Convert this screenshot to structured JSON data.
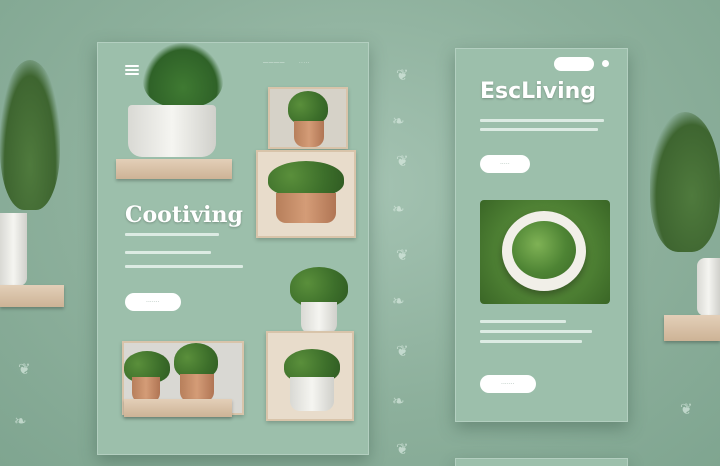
{
  "left_card": {
    "title": "Cootiving",
    "nav_links": [
      "————",
      "·····"
    ],
    "text_lines": [
      "",
      "",
      ""
    ],
    "button_label": "·······"
  },
  "right_card": {
    "title": "EscLiving",
    "button_top_label": "·····",
    "button_bottom_label": "·······"
  },
  "colors": {
    "background": "#8fb3a0",
    "card": "#9cbfab",
    "button": "#ffffff",
    "plant_green": "#3c6e2a",
    "terracotta": "#c88a63"
  },
  "icons": [
    "menu-icon",
    "leaf-doodle-icon"
  ]
}
